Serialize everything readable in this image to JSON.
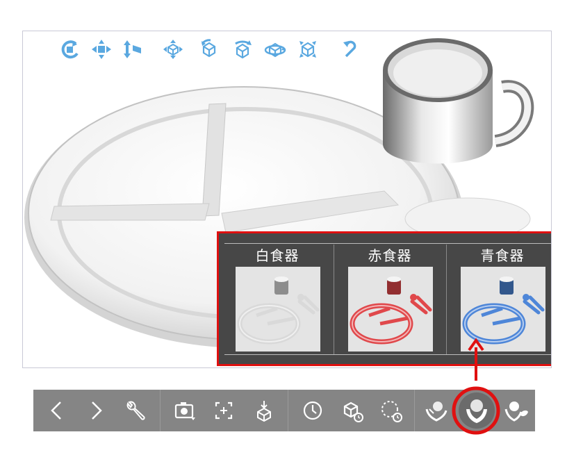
{
  "colors": {
    "nav_icon": "#5aa8e0",
    "popup_bg": "#474747",
    "highlight_red": "#e01010",
    "toolbar_bg": "#858585",
    "toolbar_icon": "#ffffff",
    "selected_button_bg": "#6b6b6b"
  },
  "viewer": {
    "nav_icons": [
      "rotate-left-icon",
      "pan-horizontal-icon",
      "pan-vertical-icon",
      "move-icon",
      "rotate-cube-icon",
      "orbit-up-icon",
      "orbit-around-icon",
      "tilt-icon",
      "undo-icon"
    ],
    "objects": [
      "divided-plate",
      "mug",
      "cutlery"
    ]
  },
  "popup": {
    "variants": [
      {
        "label": "白食器",
        "color": "#d9d9d9",
        "icon": "white-tableware-thumbnail"
      },
      {
        "label": "赤食器",
        "color": "#e0484b",
        "icon": "red-tableware-thumbnail"
      },
      {
        "label": "青食器",
        "color": "#4e86d8",
        "icon": "blue-tableware-thumbnail"
      }
    ]
  },
  "toolbar": {
    "groups": [
      [
        "back-icon",
        "forward-icon",
        "wrench-icon"
      ],
      [
        "camera-icon",
        "focus-frame-icon",
        "place-object-icon"
      ],
      [
        "timer-icon",
        "object-rotate-icon",
        "loop-rotate-icon"
      ],
      [
        "variant-gradient-icon",
        "variant-hand-icon",
        "variant-leaf-icon"
      ]
    ],
    "selected": "variant-hand-icon"
  }
}
